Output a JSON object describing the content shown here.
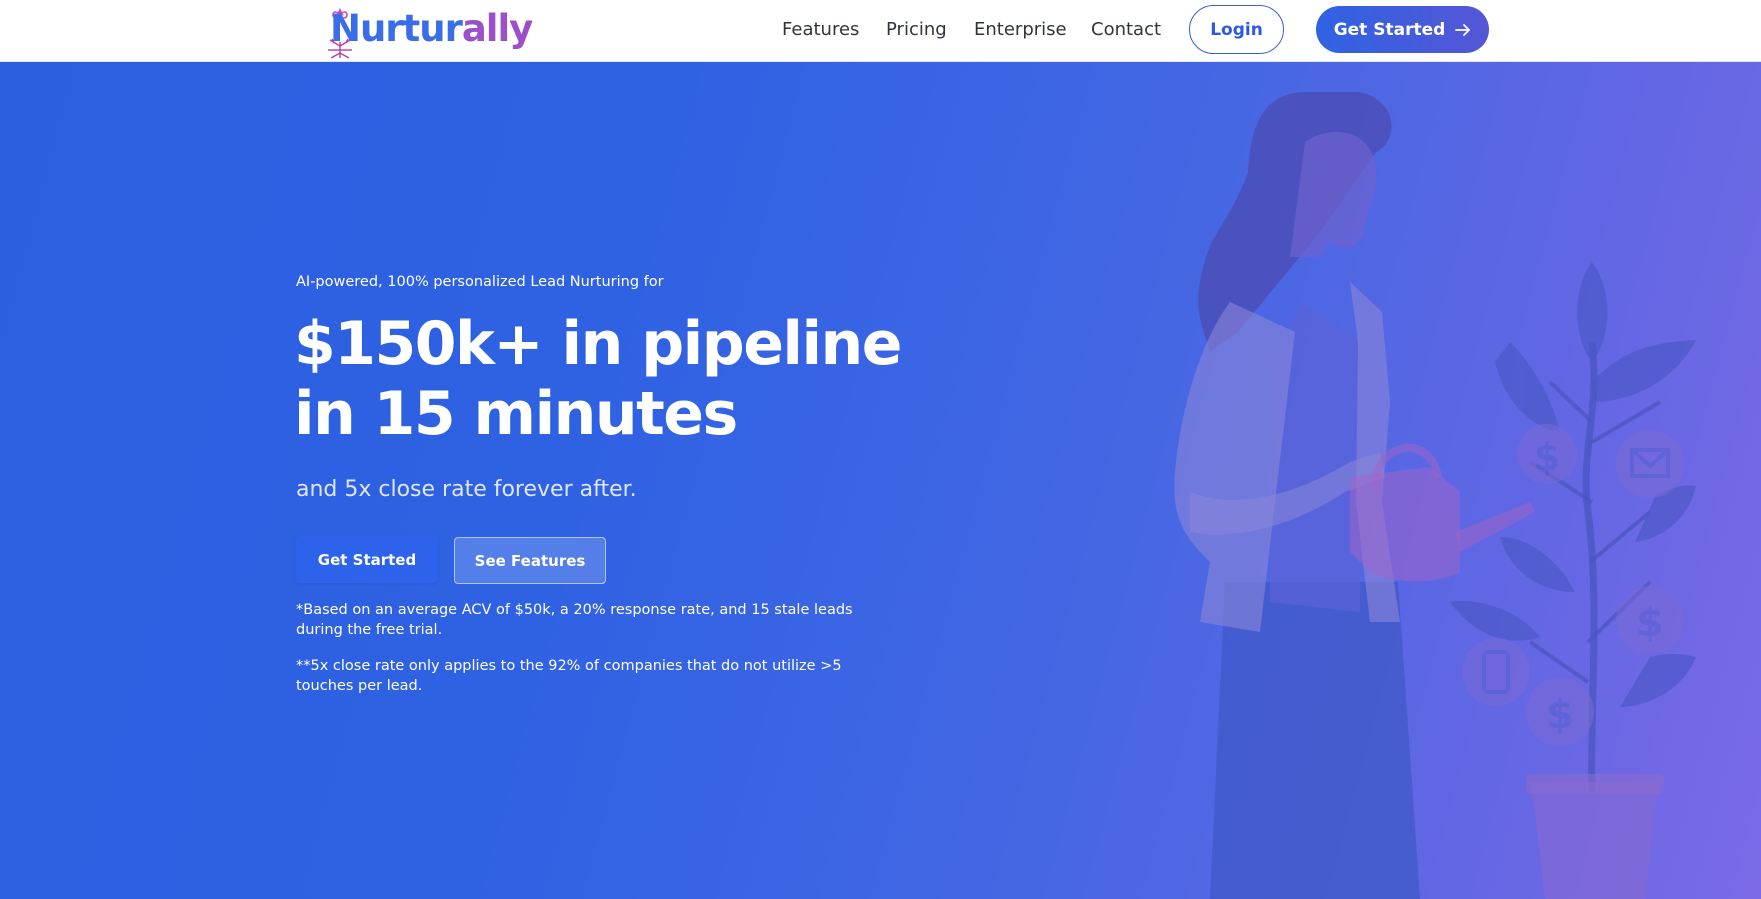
{
  "brand": {
    "name_part1": "Nurtur",
    "name_part2": "ally",
    "colors": {
      "primary": "#3a6ee8",
      "secondary": "#9b4fc9",
      "hero_start": "#2b5fe0",
      "hero_end": "#7b6ae6"
    }
  },
  "nav": {
    "links": [
      {
        "label": "Features"
      },
      {
        "label": "Pricing"
      },
      {
        "label": "Enterprise"
      },
      {
        "label": "Contact"
      }
    ],
    "login_label": "Login",
    "get_started_label": "Get Started",
    "get_started_icon": "arrow-right-icon"
  },
  "hero": {
    "eyebrow": "AI-powered, 100% personalized Lead Nurturing for",
    "headline_line1": "$150k+ in pipeline",
    "headline_line2": "in 15 minutes",
    "subhead": "and 5x close rate forever after.",
    "primary_cta": "Get Started",
    "secondary_cta": "See Features",
    "footnote1": "*Based on an average ACV of $50k, a 20% response rate, and 15 stale leads during the free trial.",
    "footnote2": "**5x close rate only applies to the 92% of companies that do not utilize >5 touches per lead.",
    "illustration": "woman-watering-money-plant-illustration",
    "illustration_icons": [
      "dollar-icon",
      "mail-icon",
      "phone-icon",
      "dollar-icon",
      "dollar-icon"
    ]
  }
}
